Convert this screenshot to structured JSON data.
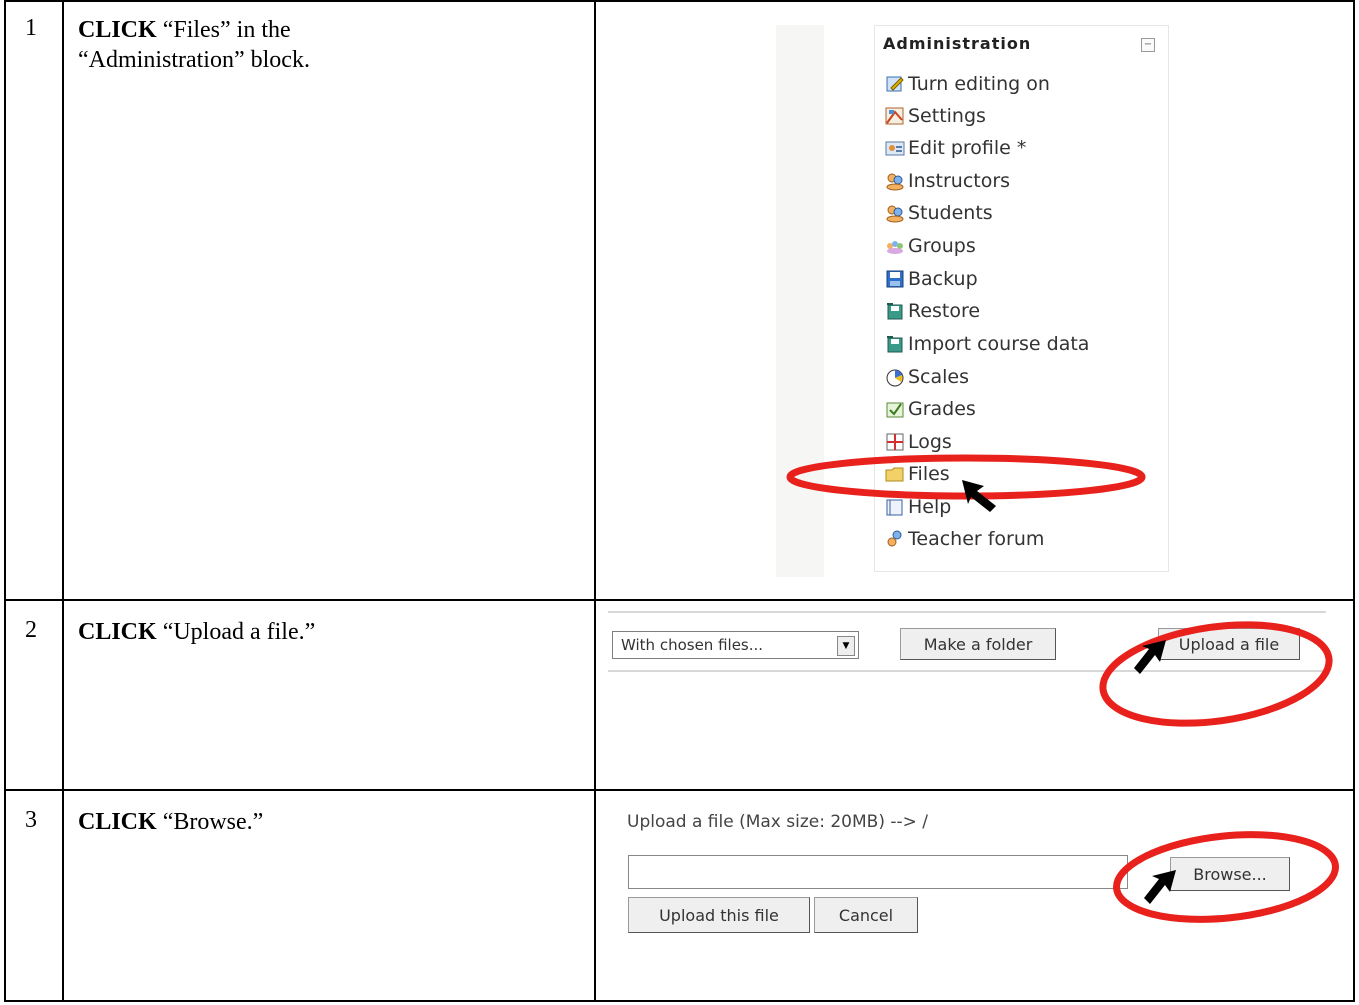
{
  "steps": [
    {
      "number": "1",
      "action": "CLICK",
      "text": " “Files” in the “Administration” block."
    },
    {
      "number": "2",
      "action": "CLICK",
      "text": " “Upload a file.”"
    },
    {
      "number": "3",
      "action": "CLICK",
      "text": " “Browse.”"
    }
  ],
  "admin_block": {
    "title": "Administration",
    "collapse_symbol": "−",
    "items": [
      {
        "label": "Turn editing on",
        "icon": "edit-icon"
      },
      {
        "label": "Settings",
        "icon": "settings-icon"
      },
      {
        "label": "Edit profile *",
        "icon": "profile-icon"
      },
      {
        "label": "Instructors",
        "icon": "users-icon"
      },
      {
        "label": "Students",
        "icon": "users-icon"
      },
      {
        "label": "Groups",
        "icon": "groups-icon"
      },
      {
        "label": "Backup",
        "icon": "backup-icon"
      },
      {
        "label": "Restore",
        "icon": "restore-icon"
      },
      {
        "label": "Import course data",
        "icon": "import-icon"
      },
      {
        "label": "Scales",
        "icon": "scales-icon"
      },
      {
        "label": "Grades",
        "icon": "grades-icon"
      },
      {
        "label": "Logs",
        "icon": "logs-icon"
      },
      {
        "label": "Files",
        "icon": "folder-icon"
      },
      {
        "label": "Help",
        "icon": "help-icon"
      },
      {
        "label": "Teacher forum",
        "icon": "forum-icon"
      }
    ]
  },
  "toolbar": {
    "select_value": "With chosen files...",
    "select_arrow": "▼",
    "make_folder_label": "Make a folder",
    "upload_label": "Upload a file"
  },
  "upload_form": {
    "title": "Upload a file (Max size: 20MB) --> /",
    "browse_label": "Browse...",
    "upload_this_label": "Upload this file",
    "cancel_label": "Cancel"
  },
  "colors": {
    "highlight": "#e8211c",
    "cursor": "#000000",
    "border": "#000000"
  }
}
